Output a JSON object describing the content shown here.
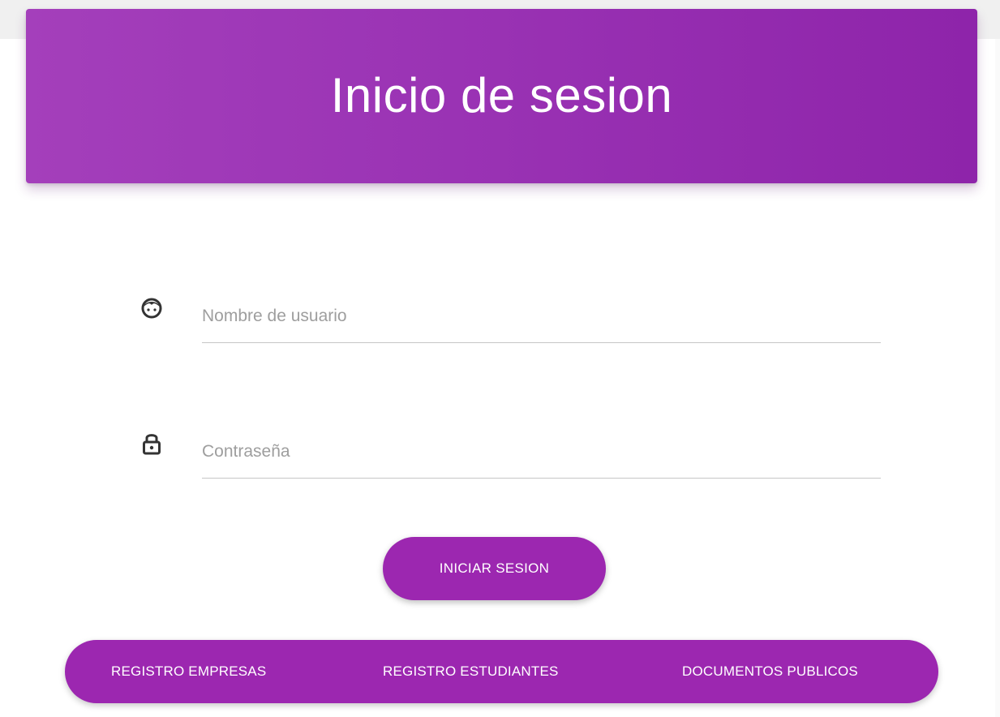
{
  "header": {
    "title": "Inicio de sesion"
  },
  "form": {
    "username": {
      "placeholder": "Nombre de usuario",
      "value": "",
      "icon": "face-icon"
    },
    "password": {
      "placeholder": "Contraseña",
      "value": "",
      "icon": "lock-icon"
    },
    "submit_label": "INICIAR SESION"
  },
  "nav": {
    "items": [
      {
        "label": "REGISTRO EMPRESAS"
      },
      {
        "label": "REGISTRO ESTUDIANTES"
      },
      {
        "label": "DOCUMENTOS PUBLICOS"
      }
    ]
  },
  "colors": {
    "accent": "#9c27b0",
    "header_start": "#a43fbb",
    "header_end": "#8e24aa",
    "text_on_accent": "#ffffff",
    "placeholder": "#9e9e9e",
    "underline": "#c6c6c6",
    "icon": "#333333"
  }
}
